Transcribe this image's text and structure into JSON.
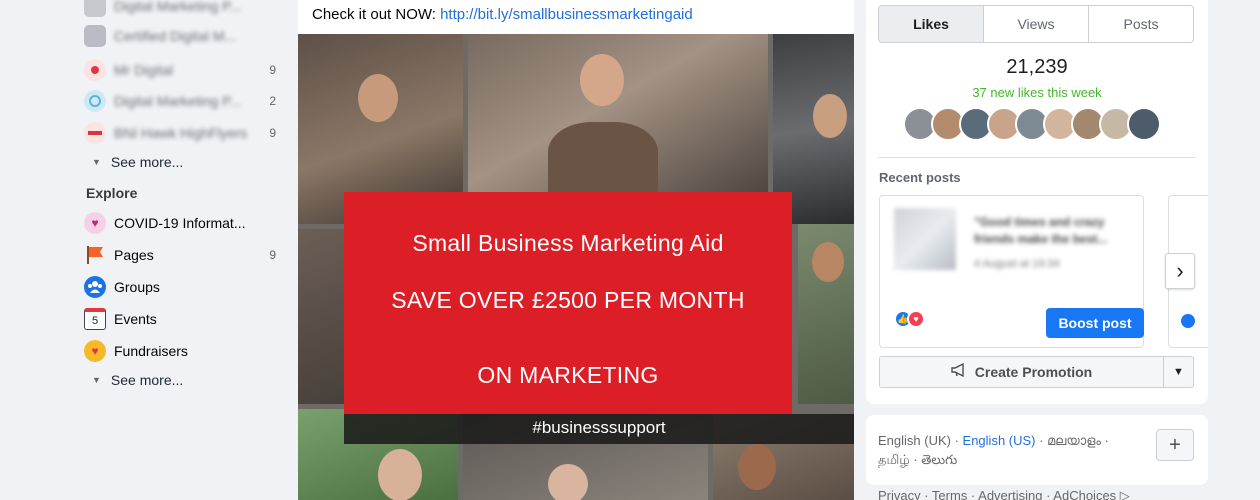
{
  "sidebar": {
    "shortcuts": [
      {
        "label": "Digital Marketing P...",
        "count": "",
        "color": "#b9bdc3"
      },
      {
        "label": "Certified Digital M...",
        "count": "",
        "color": "#b9bdc3"
      },
      {
        "label": "Mr Digital",
        "count": "9",
        "color": "#e0383e"
      },
      {
        "label": "Digital Marketing P...",
        "count": "2",
        "color": "#5bb6d6"
      },
      {
        "label": "BNI Hawk HighFlyers",
        "count": "9",
        "color": "#d23a3a"
      }
    ],
    "see_more_1": "See more...",
    "explore_title": "Explore",
    "explore": [
      {
        "label": "COVID-19 Informat...",
        "count": "",
        "icon": "heart-shield-icon"
      },
      {
        "label": "Pages",
        "count": "9",
        "icon": "flag-icon"
      },
      {
        "label": "Groups",
        "count": "",
        "icon": "groups-icon"
      },
      {
        "label": "Events",
        "count": "",
        "icon": "calendar-icon",
        "icon_text": "5"
      },
      {
        "label": "Fundraisers",
        "count": "",
        "icon": "fundraiser-icon"
      }
    ],
    "see_more_2": "See more..."
  },
  "post": {
    "text_prefix": "Check it out NOW: ",
    "link": "http://bit.ly/smallbusinessmarketingaid",
    "banner": {
      "line1": "Small Business Marketing Aid",
      "line2": "SAVE OVER £2500 PER MONTH",
      "line3": "ON MARKETING"
    },
    "hashtag": "#businesssupport"
  },
  "insights": {
    "tabs": [
      "Likes",
      "Views",
      "Posts"
    ],
    "active_tab": "Likes",
    "likes_count": "21,239",
    "new_likes": "37 new likes this week",
    "recent_posts_title": "Recent posts",
    "recent_post": {
      "text": "\"Good times and crazy friends make the best...",
      "date": "4 August at 19:34",
      "boost_label": "Boost post"
    },
    "create_promotion": "Create Promotion"
  },
  "language": {
    "current": "English (UK)",
    "sep1": " · ",
    "link1": "English (US)",
    "sep2": " · ",
    "lang3": "മലയാളം",
    "sep3": " · ",
    "lang4": "தமிழ்",
    "sep4": " · ",
    "lang5": "తెలుగు",
    "plus": "+"
  },
  "footer": "Privacy · Terms · Advertising · AdChoices ▷",
  "colors": {
    "accent": "#1877f2",
    "banner_red": "#dc1f26",
    "green": "#42b72a"
  }
}
